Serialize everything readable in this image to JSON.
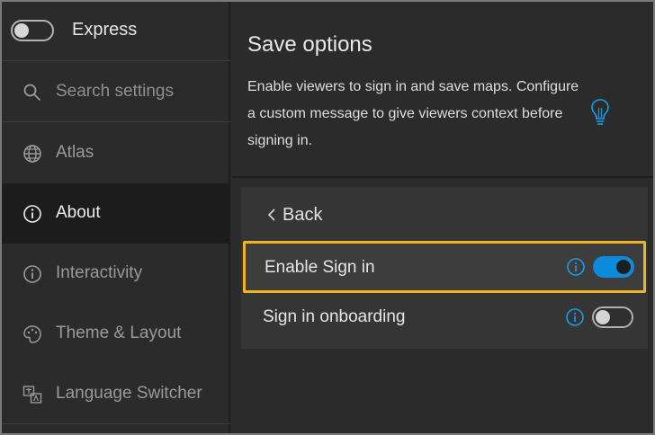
{
  "sidebar": {
    "express": {
      "label": "Express",
      "enabled": false
    },
    "search": {
      "placeholder": "Search settings"
    },
    "items": [
      {
        "label": "Atlas",
        "icon": "globe-icon",
        "active": false
      },
      {
        "label": "About",
        "icon": "info-icon",
        "active": true
      },
      {
        "label": "Interactivity",
        "icon": "info-icon",
        "active": false
      },
      {
        "label": "Theme & Layout",
        "icon": "palette-icon",
        "active": false
      },
      {
        "label": "Language Switcher",
        "icon": "translate-icon",
        "active": false
      }
    ]
  },
  "main": {
    "title": "Save options",
    "description": "Enable viewers to sign in and save maps. Configure a custom message to give viewers context before signing in.",
    "back_label": "Back",
    "settings": [
      {
        "label": "Enable Sign in",
        "enabled": true
      },
      {
        "label": "Sign in onboarding",
        "enabled": false
      }
    ]
  },
  "colors": {
    "accent": "#0b8bd9",
    "highlight": "#f0b322",
    "info": "#1a9be6"
  }
}
